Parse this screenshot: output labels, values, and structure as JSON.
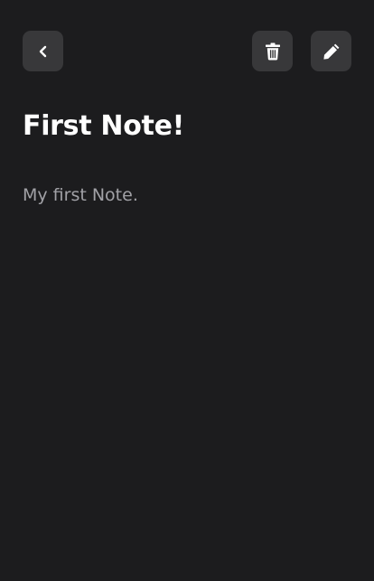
{
  "toolbar": {
    "back_icon": "chevron-left-icon",
    "delete_icon": "trash-icon",
    "edit_icon": "pencil-icon"
  },
  "note": {
    "title": "First Note!",
    "body": "My first Note."
  },
  "colors": {
    "background": "#1c1c1e",
    "button": "#38383a",
    "title": "#ffffff",
    "body_text": "#a1a1a6"
  }
}
